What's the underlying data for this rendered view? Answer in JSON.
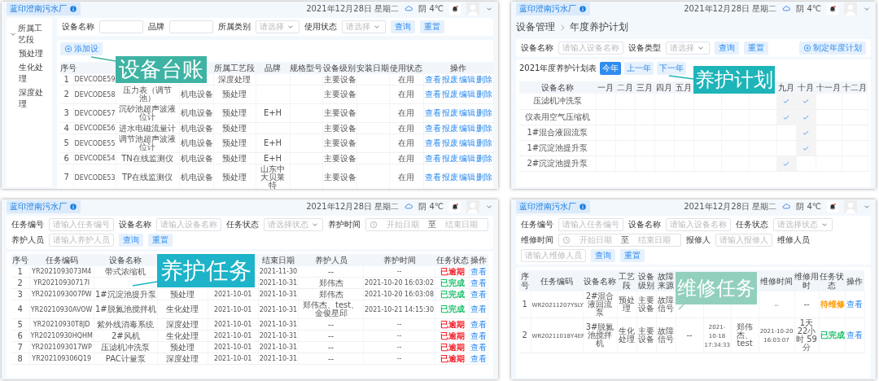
{
  "equipment_ledger": {
    "header": {
      "site": "蓝印澄南污水厂",
      "date": "2021年12月28日 星期二",
      "weather": "阴 4℃"
    },
    "callout": "设备台账",
    "sidebar": {
      "items": [
        {
          "label": "所属工艺段",
          "expanded": true,
          "children": [
            {
              "label": "预处理"
            },
            {
              "label": "生化处理"
            },
            {
              "label": "深度处理"
            }
          ]
        }
      ]
    },
    "filters": [
      {
        "kind": "input",
        "label": "设备名称"
      },
      {
        "kind": "input",
        "label": "品牌"
      },
      {
        "kind": "select",
        "label": "所属类别",
        "placeholder": "请选择"
      },
      {
        "kind": "select",
        "label": "使用状态",
        "placeholder": "请选择"
      }
    ],
    "buttons": [
      "查询",
      "重置"
    ],
    "add_button": "添加设",
    "table": {
      "columns": [
        "序号",
        null,
        null,
        null,
        "所属工艺段",
        "品牌",
        "规格型号",
        "设备级别",
        "安装日期",
        "使用状态",
        "操作"
      ],
      "rows": [
        {
          "cells": [
            "1",
            "DEVCODE59",
            null,
            null,
            "深度处理",
            null,
            null,
            "主要设备",
            null,
            "在用"
          ],
          "actions": [
            "查看",
            "报废",
            "编辑",
            "删除"
          ]
        },
        {
          "cells": [
            "2",
            "DEVCODE58",
            "压力表（调节池）",
            "机电设备",
            "预处理",
            null,
            null,
            "主要设备",
            null,
            "在用"
          ],
          "actions": [
            "查看",
            "报废",
            "编辑",
            "删除"
          ]
        },
        {
          "cells": [
            "3",
            "DEVCODE57",
            "沉砂池超声波液位计",
            "机电设备",
            "预处理",
            "E+H",
            null,
            "主要设备",
            null,
            "在用"
          ],
          "actions": [
            "查看",
            "报废",
            "编辑",
            "删除"
          ]
        },
        {
          "cells": [
            "4",
            "DEVCODE56",
            "进水电磁流量计",
            "机电设备",
            "预处理",
            null,
            null,
            "主要设备",
            null,
            "在用"
          ],
          "actions": [
            "查看",
            "报废",
            "编辑",
            "删除"
          ]
        },
        {
          "cells": [
            "5",
            "DEVCODE55",
            "调节池超声波液位计",
            "机电设备",
            "预处理",
            "E+H",
            null,
            "主要设备",
            null,
            "在用"
          ],
          "actions": [
            "查看",
            "报废",
            "编辑",
            "删除"
          ]
        },
        {
          "cells": [
            "6",
            "DEVCODE54",
            "TN在线监测仪",
            "机电设备",
            "预处理",
            "E+H",
            null,
            "主要设备",
            null,
            "在用"
          ],
          "actions": [
            "查看",
            "报废",
            "编辑",
            "删除"
          ]
        },
        {
          "cells": [
            "7",
            "DEVCODE53",
            "TP在线监测仪",
            "机电设备",
            "预处理",
            "山东中大贝莱特",
            null,
            "主要设备",
            null,
            "在用"
          ],
          "actions": [
            "查看",
            "报废",
            "编辑",
            "删除"
          ]
        }
      ]
    }
  },
  "maintenance_plan": {
    "header": {
      "site": "蓝印澄南污水厂",
      "date": "2021年12月28日 星期二",
      "weather": "阴 4℃"
    },
    "callout": "养护计划",
    "breadcrumb": [
      "设备管理",
      "年度养护计划"
    ],
    "filters": [
      {
        "kind": "input",
        "label": "设备名称",
        "placeholder": "请输入设备名称"
      },
      {
        "kind": "select",
        "label": "设备类型",
        "placeholder": "请选择"
      }
    ],
    "buttons": [
      "查询",
      "重置"
    ],
    "plan_button": "制定年度计划",
    "title": "2021年度养护计划表",
    "year_buttons": [
      {
        "label": "今年",
        "selected": true
      },
      {
        "label": "上一年",
        "selected": false
      },
      {
        "label": "下一年",
        "selected": false
      }
    ],
    "table": {
      "columns": [
        "设备名称",
        "一月",
        "二月",
        "三月",
        "四月",
        "五月",
        null,
        null,
        null,
        "九月",
        "十月",
        "十一月",
        "十二月"
      ],
      "rows": [
        {
          "name": "压滤机冲洗泵",
          "plan": [
            false,
            false,
            false,
            false,
            false,
            false,
            false,
            false,
            true,
            true,
            false,
            false
          ]
        },
        {
          "name": "仪表用空气压缩机",
          "plan": [
            false,
            false,
            false,
            false,
            false,
            false,
            false,
            false,
            true,
            true,
            false,
            false
          ]
        },
        {
          "name": "1#混合液回流泵",
          "plan": [
            false,
            false,
            false,
            false,
            false,
            false,
            false,
            false,
            false,
            true,
            false,
            false
          ]
        },
        {
          "name": "1#沉淀池提升泵",
          "plan": [
            false,
            false,
            false,
            false,
            false,
            false,
            false,
            false,
            false,
            true,
            false,
            false
          ]
        },
        {
          "name": "2#沉淀池提升泵",
          "plan": [
            false,
            false,
            false,
            false,
            false,
            false,
            false,
            false,
            true,
            false,
            false,
            false
          ]
        }
      ]
    }
  },
  "maintenance_tasks": {
    "header": {
      "site": "蓝印澄南污水厂",
      "date": "2021年12月28日 星期二",
      "weather": "阴 4℃"
    },
    "callout": "养护任务",
    "filters": [
      {
        "kind": "input",
        "label": "任务编号",
        "placeholder": "请输入任务编号"
      },
      {
        "kind": "input",
        "label": "设备名称",
        "placeholder": "请输入设备名称"
      },
      {
        "kind": "select",
        "label": "任务状态",
        "placeholder": "请选择状态"
      },
      {
        "kind": "daterange",
        "label": "养护时间",
        "start": "开始日期",
        "separator": "至",
        "end": "结束日期"
      },
      {
        "kind": "input",
        "label": "养护人员",
        "placeholder": "请输入养护人员"
      }
    ],
    "buttons": [
      "查询",
      "重置"
    ],
    "table": {
      "columns": [
        "序号",
        "任务编码",
        "设备名称",
        null,
        null,
        "结束日期",
        "养护人员",
        "养护时间",
        "任务状态",
        "操作"
      ],
      "rows": [
        {
          "cells": [
            "1",
            "YR2021093073M4",
            "带式浓缩机",
            null,
            null,
            "2021-11-30",
            "--",
            "--"
          ],
          "status": "已逾期",
          "color": "#f5222d",
          "actions": [
            "查看"
          ]
        },
        {
          "cells": [
            "2",
            "YR20210930717I",
            null,
            null,
            null,
            "2021-10-31",
            "郑伟杰",
            "2021-10-20 16:03:02"
          ],
          "status": "已完成",
          "color": "#19be6b",
          "actions": [
            "查看"
          ]
        },
        {
          "cells": [
            "3",
            "YR2021093007PW",
            "1#沉淀池提升泵",
            "预处理",
            "2021-10-01",
            "2021-10-31",
            "郑伟杰",
            "2021-10-20 16:03:08"
          ],
          "status": "已完成",
          "color": "#19be6b",
          "actions": [
            "查看"
          ]
        },
        {
          "cells": [
            "4",
            "YR20210930AVOW",
            "1#脱氮池搅拌机",
            "生化处理",
            "2021-10-01",
            "2021-10-31",
            "郑伟杰、test、金俊星邱",
            "2021-10-21 14:15:30"
          ],
          "status": "已完成",
          "color": "#19be6b",
          "actions": [
            "查看"
          ]
        },
        {
          "cells": [
            "5",
            "YR20210930T8JD",
            "紫外线消毒系统",
            "深度处理",
            "2021-10-01",
            "2021-10-31",
            "--",
            "--"
          ],
          "status": "已逾期",
          "color": "#f5222d",
          "actions": [
            "查看"
          ]
        },
        {
          "cells": [
            "6",
            "YR20210930HQHM",
            "2#风机",
            "生化处理",
            "2021-10-01",
            "2021-10-31",
            "--",
            "--"
          ],
          "status": "已逾期",
          "color": "#f5222d",
          "actions": [
            "查看"
          ]
        },
        {
          "cells": [
            "7",
            "YR2021093017WP",
            "压滤机冲洗泵",
            "预处理",
            "2021-10-01",
            "2021-10-31",
            "--",
            "--"
          ],
          "status": "已逾期",
          "color": "#f5222d",
          "actions": [
            "查看"
          ]
        },
        {
          "cells": [
            "8",
            "YR202109306Q19",
            "PAC计量泵",
            "深度处理",
            "2021-10-01",
            "2021-10-31",
            "--",
            "--"
          ],
          "status": "已逾期",
          "color": "#f5222d",
          "actions": [
            "查看"
          ]
        }
      ]
    }
  },
  "repair_tasks": {
    "header": {
      "site": "蓝印澄南污水厂",
      "date": "2021年12月28日 星期二",
      "weather": "阴 4℃"
    },
    "callout": "维修任务",
    "filters": [
      {
        "kind": "input",
        "label": "任务编号",
        "placeholder": "请输入任务编号"
      },
      {
        "kind": "input",
        "label": "设备名称",
        "placeholder": "请输入设备名称"
      },
      {
        "kind": "select",
        "label": "任务状态",
        "placeholder": "请选择状态"
      },
      {
        "kind": "daterange",
        "label": "维修时间",
        "start": "开始日期",
        "separator": "至",
        "end": "结束日期"
      },
      {
        "kind": "input",
        "label": "报修人",
        "placeholder": "请输入报修人"
      },
      {
        "kind": "input",
        "label": "维修人员",
        "placeholder": "请输入维修人员"
      }
    ],
    "buttons": [
      "查询",
      "重置"
    ],
    "table": {
      "columns": [
        "序号",
        "任务编码",
        "设备名称",
        "工艺段",
        "设备级别",
        "故障来源",
        null,
        null,
        null,
        "维修时间",
        "维修用时",
        "任务状态",
        "操作"
      ],
      "rows": [
        {
          "cells": [
            "1",
            "WR20211207YSLY",
            "2#混合液回流泵",
            "预处理",
            "主要设备",
            "故障信号",
            null,
            null,
            null,
            "--",
            "--"
          ],
          "status": "待维修",
          "color": "#ff9900",
          "actions": [
            "查看"
          ]
        },
        {
          "cells": [
            "2",
            "WR20211018Y4EF",
            "3#脱氮池搅拌机",
            "生化处理",
            "主要设备",
            "故障信号",
            "--",
            "2021-10-18 17:34:33",
            "郑伟杰、test",
            "2021-10-20 16:03:07",
            "1天 22小时 59分"
          ],
          "status": "已完成",
          "color": "#19be6b",
          "actions": [
            "查看"
          ]
        }
      ]
    }
  }
}
